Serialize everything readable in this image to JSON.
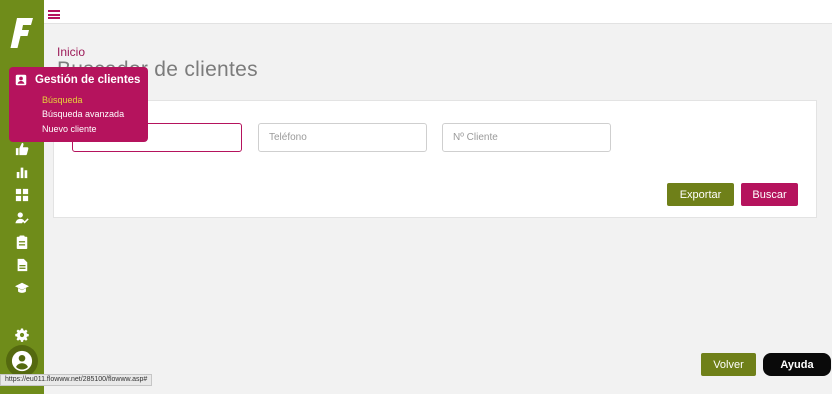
{
  "sidebar": {
    "logo_letter": "F",
    "icons": [
      "contacts-icon",
      "calendar-icon",
      "archive-icon",
      "thumbs-up-icon",
      "bar-chart-icon",
      "dashboard-icon",
      "person-check-icon",
      "clipboard-icon",
      "document-icon",
      "graduation-cap-icon"
    ],
    "bottom_icons": [
      "gear-icon",
      "account-icon"
    ]
  },
  "topbar": {
    "menu_icon": "hamburger-icon"
  },
  "breadcrumb": "Inicio",
  "page_title": "Buscador de clientes",
  "search": {
    "fields": [
      {
        "placeholder": "",
        "value": ""
      },
      {
        "placeholder": "Teléfono",
        "value": ""
      },
      {
        "placeholder": "Nº Cliente",
        "value": ""
      }
    ],
    "export_label": "Exportar",
    "search_label": "Buscar"
  },
  "flyout": {
    "title": "Gestión de clientes",
    "items": [
      {
        "label": "Búsqueda",
        "active": true
      },
      {
        "label": "Búsqueda avanzada",
        "active": false
      },
      {
        "label": "Nuevo cliente",
        "active": false
      }
    ]
  },
  "footer": {
    "back_label": "Volver",
    "help_label": "Ayuda"
  },
  "status_url": "https://eu011.flowww.net/285100/flowww.asp#",
  "colors": {
    "sidebar": "#6f8c1a",
    "accent": "#b5135d",
    "olive_button": "#6f8019",
    "active_item": "#e6d43a"
  }
}
